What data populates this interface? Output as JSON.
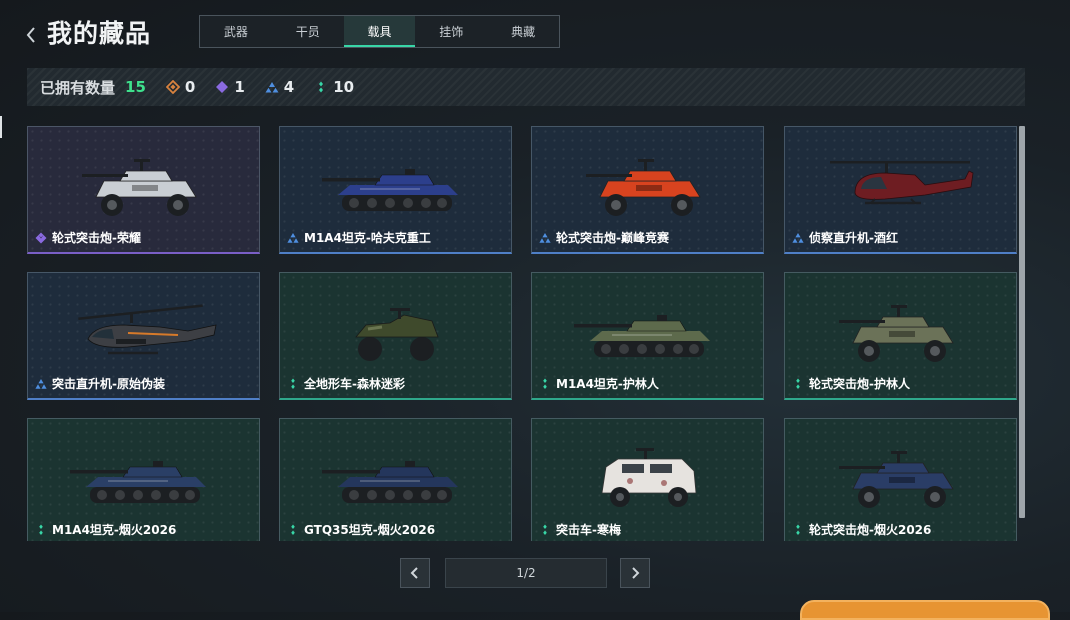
{
  "header": {
    "title": "我的藏品",
    "back_icon": "chevron-left-icon"
  },
  "tabs": [
    {
      "label": "武器",
      "active": false
    },
    {
      "label": "干员",
      "active": false
    },
    {
      "label": "载具",
      "active": true
    },
    {
      "label": "挂饰",
      "active": false
    },
    {
      "label": "典藏",
      "active": false
    }
  ],
  "stats": {
    "owned_label": "已拥有数量",
    "owned_count": "15",
    "owned_count_color": "#3ee08c",
    "tiers": [
      {
        "icon": "orange-diamond-icon",
        "color": "#d9833e",
        "count": "0"
      },
      {
        "icon": "purple-diamond-icon",
        "color": "#8a6ae0",
        "count": "1"
      },
      {
        "icon": "blue-triangle-icon",
        "color": "#4f8fe0",
        "count": "4"
      },
      {
        "icon": "green-dots-icon",
        "color": "#38d6a7",
        "count": "10"
      }
    ]
  },
  "rarity_colors": {
    "purple": "#7a5fc7",
    "blue": "#4f7fc7",
    "green": "#2fa88b"
  },
  "items": [
    {
      "name": "轮式突击炮-荣耀",
      "rarity": "purple",
      "vehicle": "wheeled-assault-gun",
      "paint": "#c9ced3"
    },
    {
      "name": "M1A4坦克-哈夫克重工",
      "rarity": "blue",
      "vehicle": "tank",
      "paint": "#2c3f8c"
    },
    {
      "name": "轮式突击炮-巅峰竞赛",
      "rarity": "blue",
      "vehicle": "wheeled-assault-gun",
      "paint": "#d8431f"
    },
    {
      "name": "侦察直升机-酒红",
      "rarity": "blue",
      "vehicle": "scout-helicopter",
      "paint": "#6e1d22"
    },
    {
      "name": "突击直升机-原始伪装",
      "rarity": "blue",
      "vehicle": "attack-helicopter",
      "paint": "#3d3f44"
    },
    {
      "name": "全地形车-森林迷彩",
      "rarity": "green",
      "vehicle": "atv",
      "paint": "#3f4a2c"
    },
    {
      "name": "M1A4坦克-护林人",
      "rarity": "green",
      "vehicle": "tank",
      "paint": "#5d6a4c"
    },
    {
      "name": "轮式突击炮-护林人",
      "rarity": "green",
      "vehicle": "wheeled-assault-gun",
      "paint": "#6b7258"
    },
    {
      "name": "M1A4坦克-烟火2026",
      "rarity": "green",
      "vehicle": "tank",
      "paint": "#2a3f66"
    },
    {
      "name": "GTQ35坦克-烟火2026",
      "rarity": "green",
      "vehicle": "tank",
      "paint": "#24365c"
    },
    {
      "name": "突击车-寒梅",
      "rarity": "green",
      "vehicle": "armored-car",
      "paint": "#e6e3df"
    },
    {
      "name": "轮式突击炮-烟火2026",
      "rarity": "green",
      "vehicle": "wheeled-assault-gun",
      "paint": "#2a3d66"
    }
  ],
  "pagination": {
    "page": "1/2",
    "prev_icon": "chevron-left-icon",
    "next_icon": "chevron-right-icon"
  }
}
